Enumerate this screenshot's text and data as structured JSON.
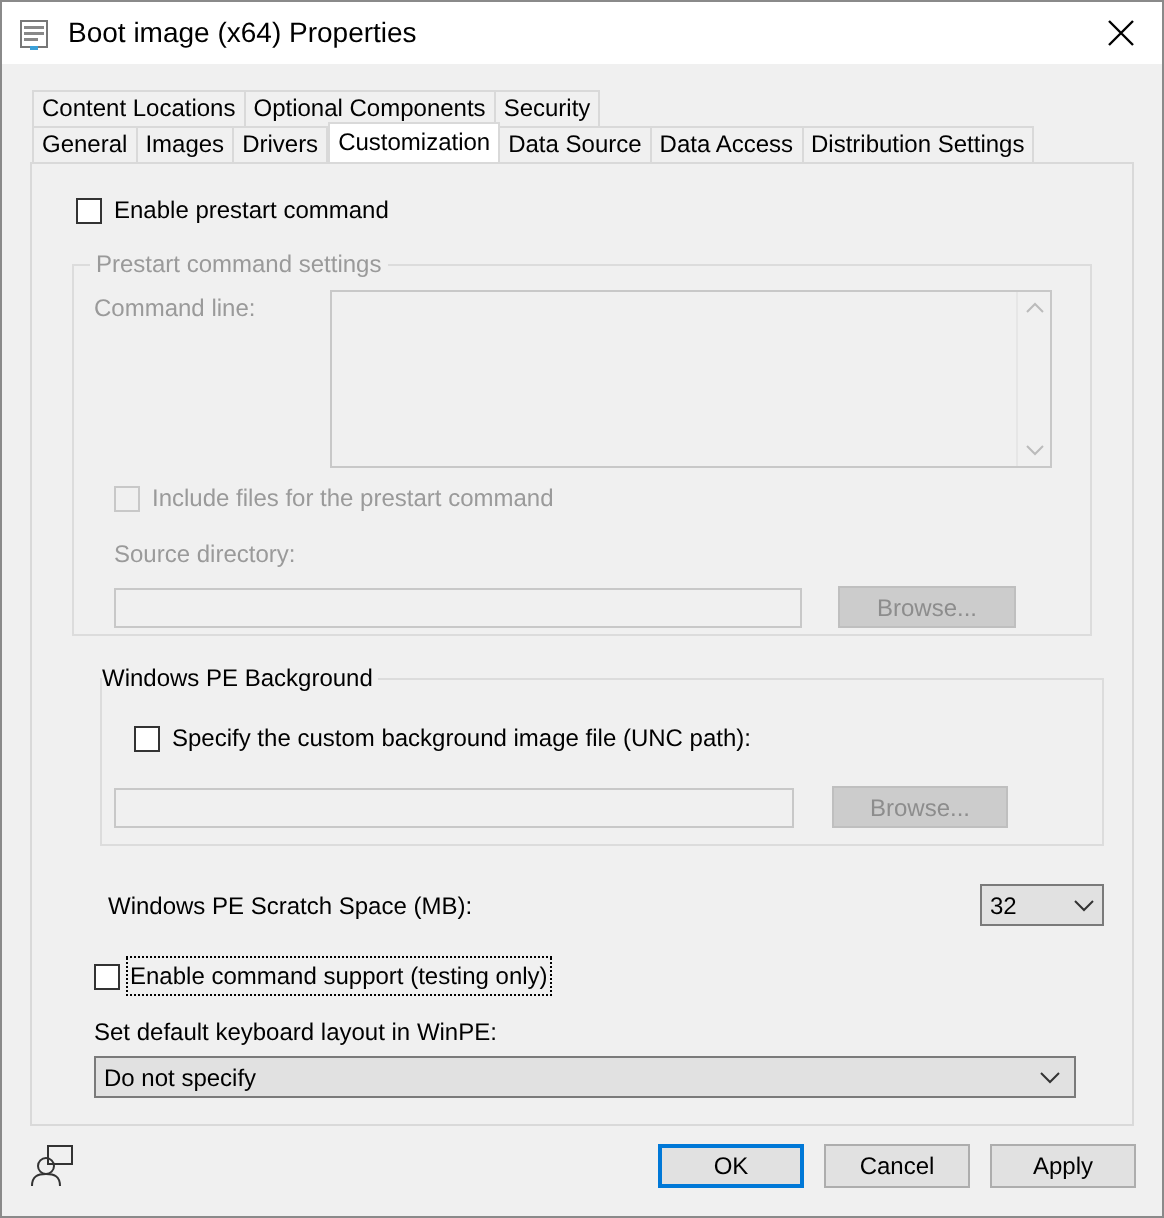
{
  "window": {
    "title": "Boot image (x64) Properties"
  },
  "tab_rows": [
    [
      {
        "label": "Content Locations",
        "selected": false
      },
      {
        "label": "Optional Components",
        "selected": false
      },
      {
        "label": "Security",
        "selected": false
      }
    ],
    [
      {
        "label": "General",
        "selected": false
      },
      {
        "label": "Images",
        "selected": false
      },
      {
        "label": "Drivers",
        "selected": false
      },
      {
        "label": "Customization",
        "selected": true
      },
      {
        "label": "Data Source",
        "selected": false
      },
      {
        "label": "Data Access",
        "selected": false
      },
      {
        "label": "Distribution Settings",
        "selected": false
      }
    ]
  ],
  "enable_prestart": {
    "label": "Enable prestart command",
    "checked": false
  },
  "prestart_group": {
    "title": "Prestart command settings",
    "disabled": true,
    "command_line_label": "Command line:",
    "include_files": {
      "label": "Include files for the prestart command",
      "checked": false
    },
    "source_directory_label": "Source directory:",
    "browse_button": "Browse..."
  },
  "pe_background": {
    "title": "Windows PE Background",
    "checkbox": {
      "label": "Specify the custom background image file (UNC path):",
      "checked": false
    },
    "disabled": true,
    "browse_button": "Browse..."
  },
  "scratch_space": {
    "label": "Windows PE Scratch Space (MB):",
    "value": "32"
  },
  "command_support": {
    "label": "Enable command support (testing only)",
    "checked": false,
    "focused": true
  },
  "keyboard": {
    "label": "Set default keyboard layout in WinPE:",
    "value": "Do not specify"
  },
  "buttons": [
    {
      "label": "OK",
      "default": true
    },
    {
      "label": "Cancel",
      "default": false
    },
    {
      "label": "Apply",
      "default": false
    }
  ]
}
